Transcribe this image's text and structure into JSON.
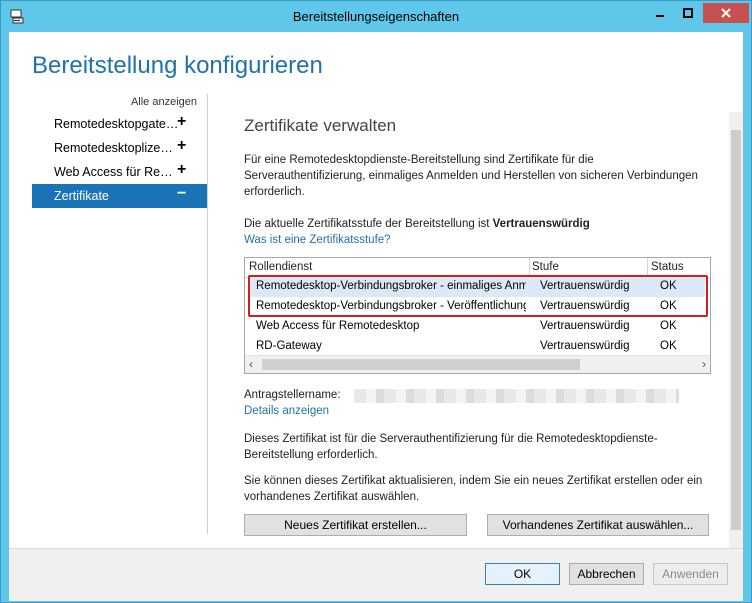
{
  "window": {
    "title": "Bereitstellungseigenschaften"
  },
  "header": {
    "title": "Bereitstellung konfigurieren"
  },
  "sidebar": {
    "show_all": "Alle anzeigen",
    "items": [
      {
        "label": "Remotedesktopgateway",
        "sign": "+"
      },
      {
        "label": "Remotedesktoplizenzierung",
        "sign": "+"
      },
      {
        "label": "Web Access für Remotedesktop",
        "sign": "+"
      },
      {
        "label": "Zertifikate",
        "sign": "−"
      }
    ]
  },
  "main": {
    "title": "Zertifikate verwalten",
    "intro": "Für eine Remotedesktopdienste-Bereitstellung sind Zertifikate für die Serverauthentifizierung, einmaliges Anmelden und Herstellen von sicheren Verbindungen erforderlich.",
    "level_prefix": "Die aktuelle Zertifikatsstufe der Bereitstellung ist ",
    "level_value": "Vertrauenswürdig",
    "level_link": "Was ist eine Zertifikatsstufe?",
    "table": {
      "headers": [
        "Rollendienst",
        "Stufe",
        "Status"
      ],
      "rows": [
        {
          "role": "Remotedesktop-Verbindungsbroker - einmaliges Anmelden aktivieren",
          "level": "Vertrauenswürdig",
          "status": "OK"
        },
        {
          "role": "Remotedesktop-Verbindungsbroker - Veröffentlichung",
          "level": "Vertrauenswürdig",
          "status": "OK"
        },
        {
          "role": "Web Access für Remotedesktop",
          "level": "Vertrauenswürdig",
          "status": "OK"
        },
        {
          "role": "RD-Gateway",
          "level": "Vertrauenswürdig",
          "status": "OK"
        }
      ]
    },
    "requester_label": "Antragstellername:",
    "details_link": "Details anzeigen",
    "desc1": "Dieses Zertifikat ist für die Serverauthentifizierung für die Remotedesktopdienste-Bereitstellung erforderlich.",
    "desc2": "Sie können dieses Zertifikat aktualisieren, indem Sie ein neues Zertifikat erstellen oder ein vorhandenes Zertifikat auswählen.",
    "btn_new": "Neues Zertifikat erstellen...",
    "btn_existing": "Vorhandenes Zertifikat auswählen..."
  },
  "footer": {
    "ok": "OK",
    "cancel": "Abbrechen",
    "apply": "Anwenden"
  }
}
